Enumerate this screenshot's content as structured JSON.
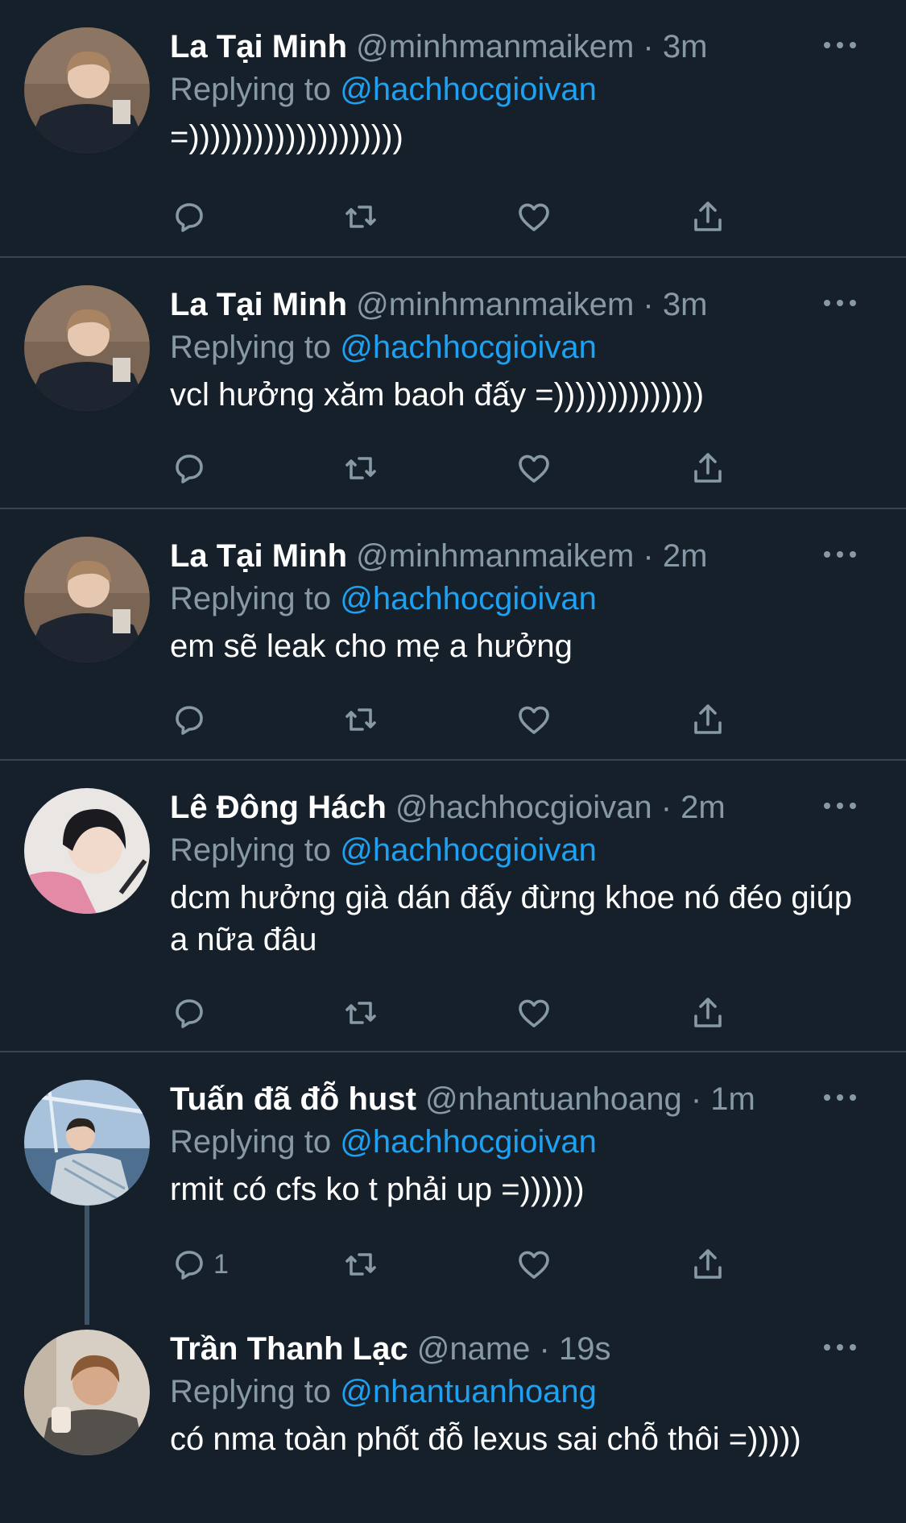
{
  "colors": {
    "background": "#15202b",
    "divider": "#38444d",
    "secondary_text": "#8899a6",
    "mention": "#1da1f2",
    "primary_text": "#ffffff"
  },
  "icons": {
    "reply": "reply-icon",
    "retweet": "retweet-icon",
    "like": "heart-icon",
    "share": "share-icon",
    "more": "more-options-icon"
  },
  "tweets": [
    {
      "name": "La Tại Minh",
      "handle": "@minhmanmaikem",
      "time": "· 3m",
      "replying_label": "Replying to",
      "replying_to": "@hachhocgioivan",
      "text": "=))))))))))))))))))))",
      "reply_count": ""
    },
    {
      "name": "La Tại Minh",
      "handle": "@minhmanmaikem",
      "time": "· 3m",
      "replying_label": "Replying to",
      "replying_to": "@hachhocgioivan",
      "text": "vcl hưởng xăm baoh đấy =))))))))))))))",
      "reply_count": ""
    },
    {
      "name": "La Tại Minh",
      "handle": "@minhmanmaikem",
      "time": "· 2m",
      "replying_label": "Replying to",
      "replying_to": "@hachhocgioivan",
      "text": "em sẽ leak cho mẹ a hưởng",
      "reply_count": ""
    },
    {
      "name": "Lê Đông Hách",
      "handle": "@hachhocgioivan",
      "time": "· 2m",
      "replying_label": "Replying to",
      "replying_to": "@hachhocgioivan",
      "text": "dcm hưởng già dán đấy đừng khoe nó đéo giúp a nữa đâu",
      "reply_count": ""
    },
    {
      "name": "Tuấn đã đỗ hust",
      "handle": "@nhantuanhoang",
      "time": "· 1m",
      "replying_label": "Replying to",
      "replying_to": "@hachhocgioivan",
      "text": "rmit có cfs ko t phải up =))))))",
      "reply_count": "1"
    },
    {
      "name": "Trần Thanh Lạc",
      "handle": "@name",
      "time": "· 19s",
      "replying_label": "Replying to",
      "replying_to": "@nhantuanhoang",
      "text": "có nma toàn phốt đỗ lexus sai chỗ thôi =)))))",
      "reply_count": ""
    }
  ]
}
